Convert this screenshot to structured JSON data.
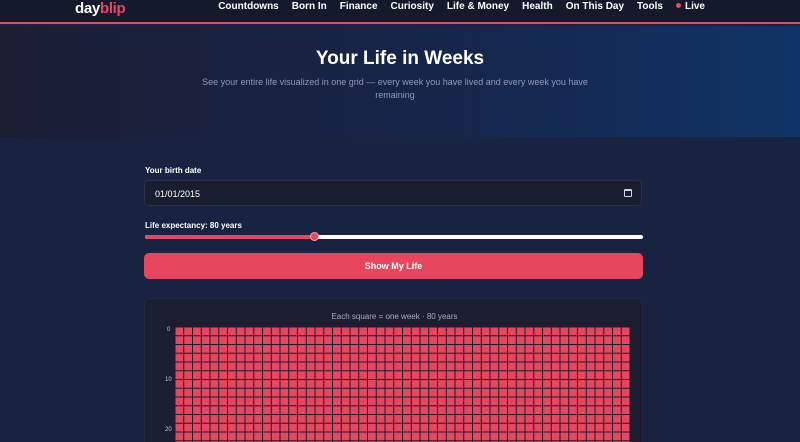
{
  "nav": {
    "logo_part1": "day",
    "logo_part2": "blip",
    "items": [
      "Countdowns",
      "Born In",
      "Finance",
      "Curiosity",
      "Life & Money",
      "Health",
      "On This Day"
    ],
    "tools": "Tools",
    "live": "Live",
    "accent_color": "#e8465f"
  },
  "hero": {
    "title": "Your Life in Weeks",
    "subtitle": "See your entire life visualized in one grid — every week you have lived and every week you have remaining"
  },
  "form": {
    "birth_label": "Your birth date",
    "birth_value": "01/01/2015",
    "calendar_icon": "calendar-icon",
    "expectancy_label": "Life expectancy: 80 years",
    "expectancy_fraction": 0.34,
    "button_label": "Show My Life"
  },
  "grid": {
    "caption": "Each square = one week · 80 years",
    "year_labels": [
      "0",
      "10",
      "20"
    ],
    "weeks_per_year": 52,
    "lived_years_full": 20,
    "lived_extra_weeks": 23,
    "lived_color": "#e8465f",
    "remaining_color": "#2b2e40"
  }
}
